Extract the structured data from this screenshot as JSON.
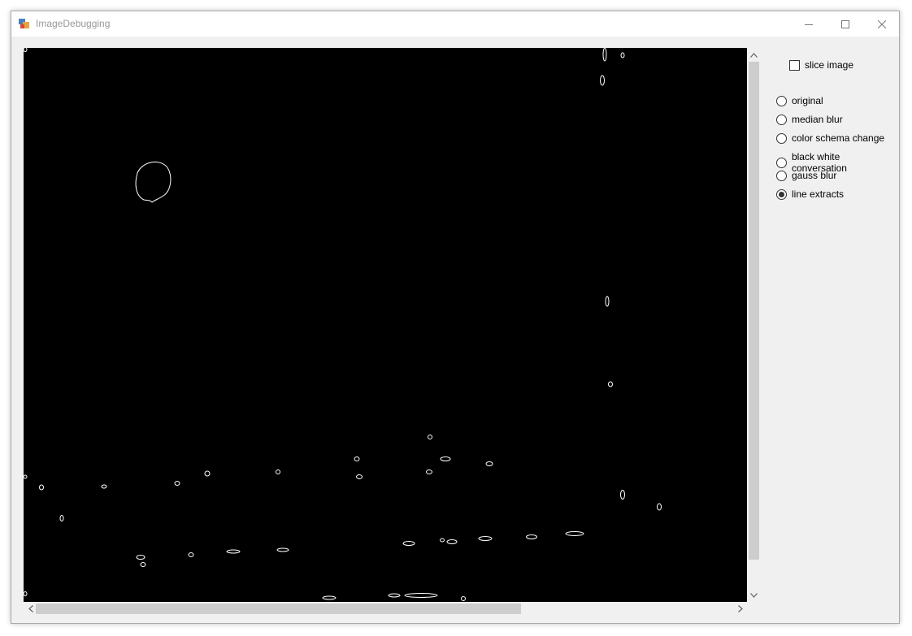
{
  "window": {
    "title": "ImageDebugging"
  },
  "options": {
    "slice_image_label": "slice image",
    "slice_image_checked": false,
    "modes": [
      {
        "label": "original",
        "checked": false
      },
      {
        "label": "median blur",
        "checked": false
      },
      {
        "label": "color schema change",
        "checked": false
      },
      {
        "label": "black white conversation",
        "checked": false
      },
      {
        "label": "gauss blur",
        "checked": false
      },
      {
        "label": "line extracts",
        "checked": true
      }
    ]
  },
  "colors": {
    "canvas": "#000000",
    "edges": "#ffffff",
    "window": "#f0f0f0",
    "scroll_thumb": "#cdcdcd"
  }
}
